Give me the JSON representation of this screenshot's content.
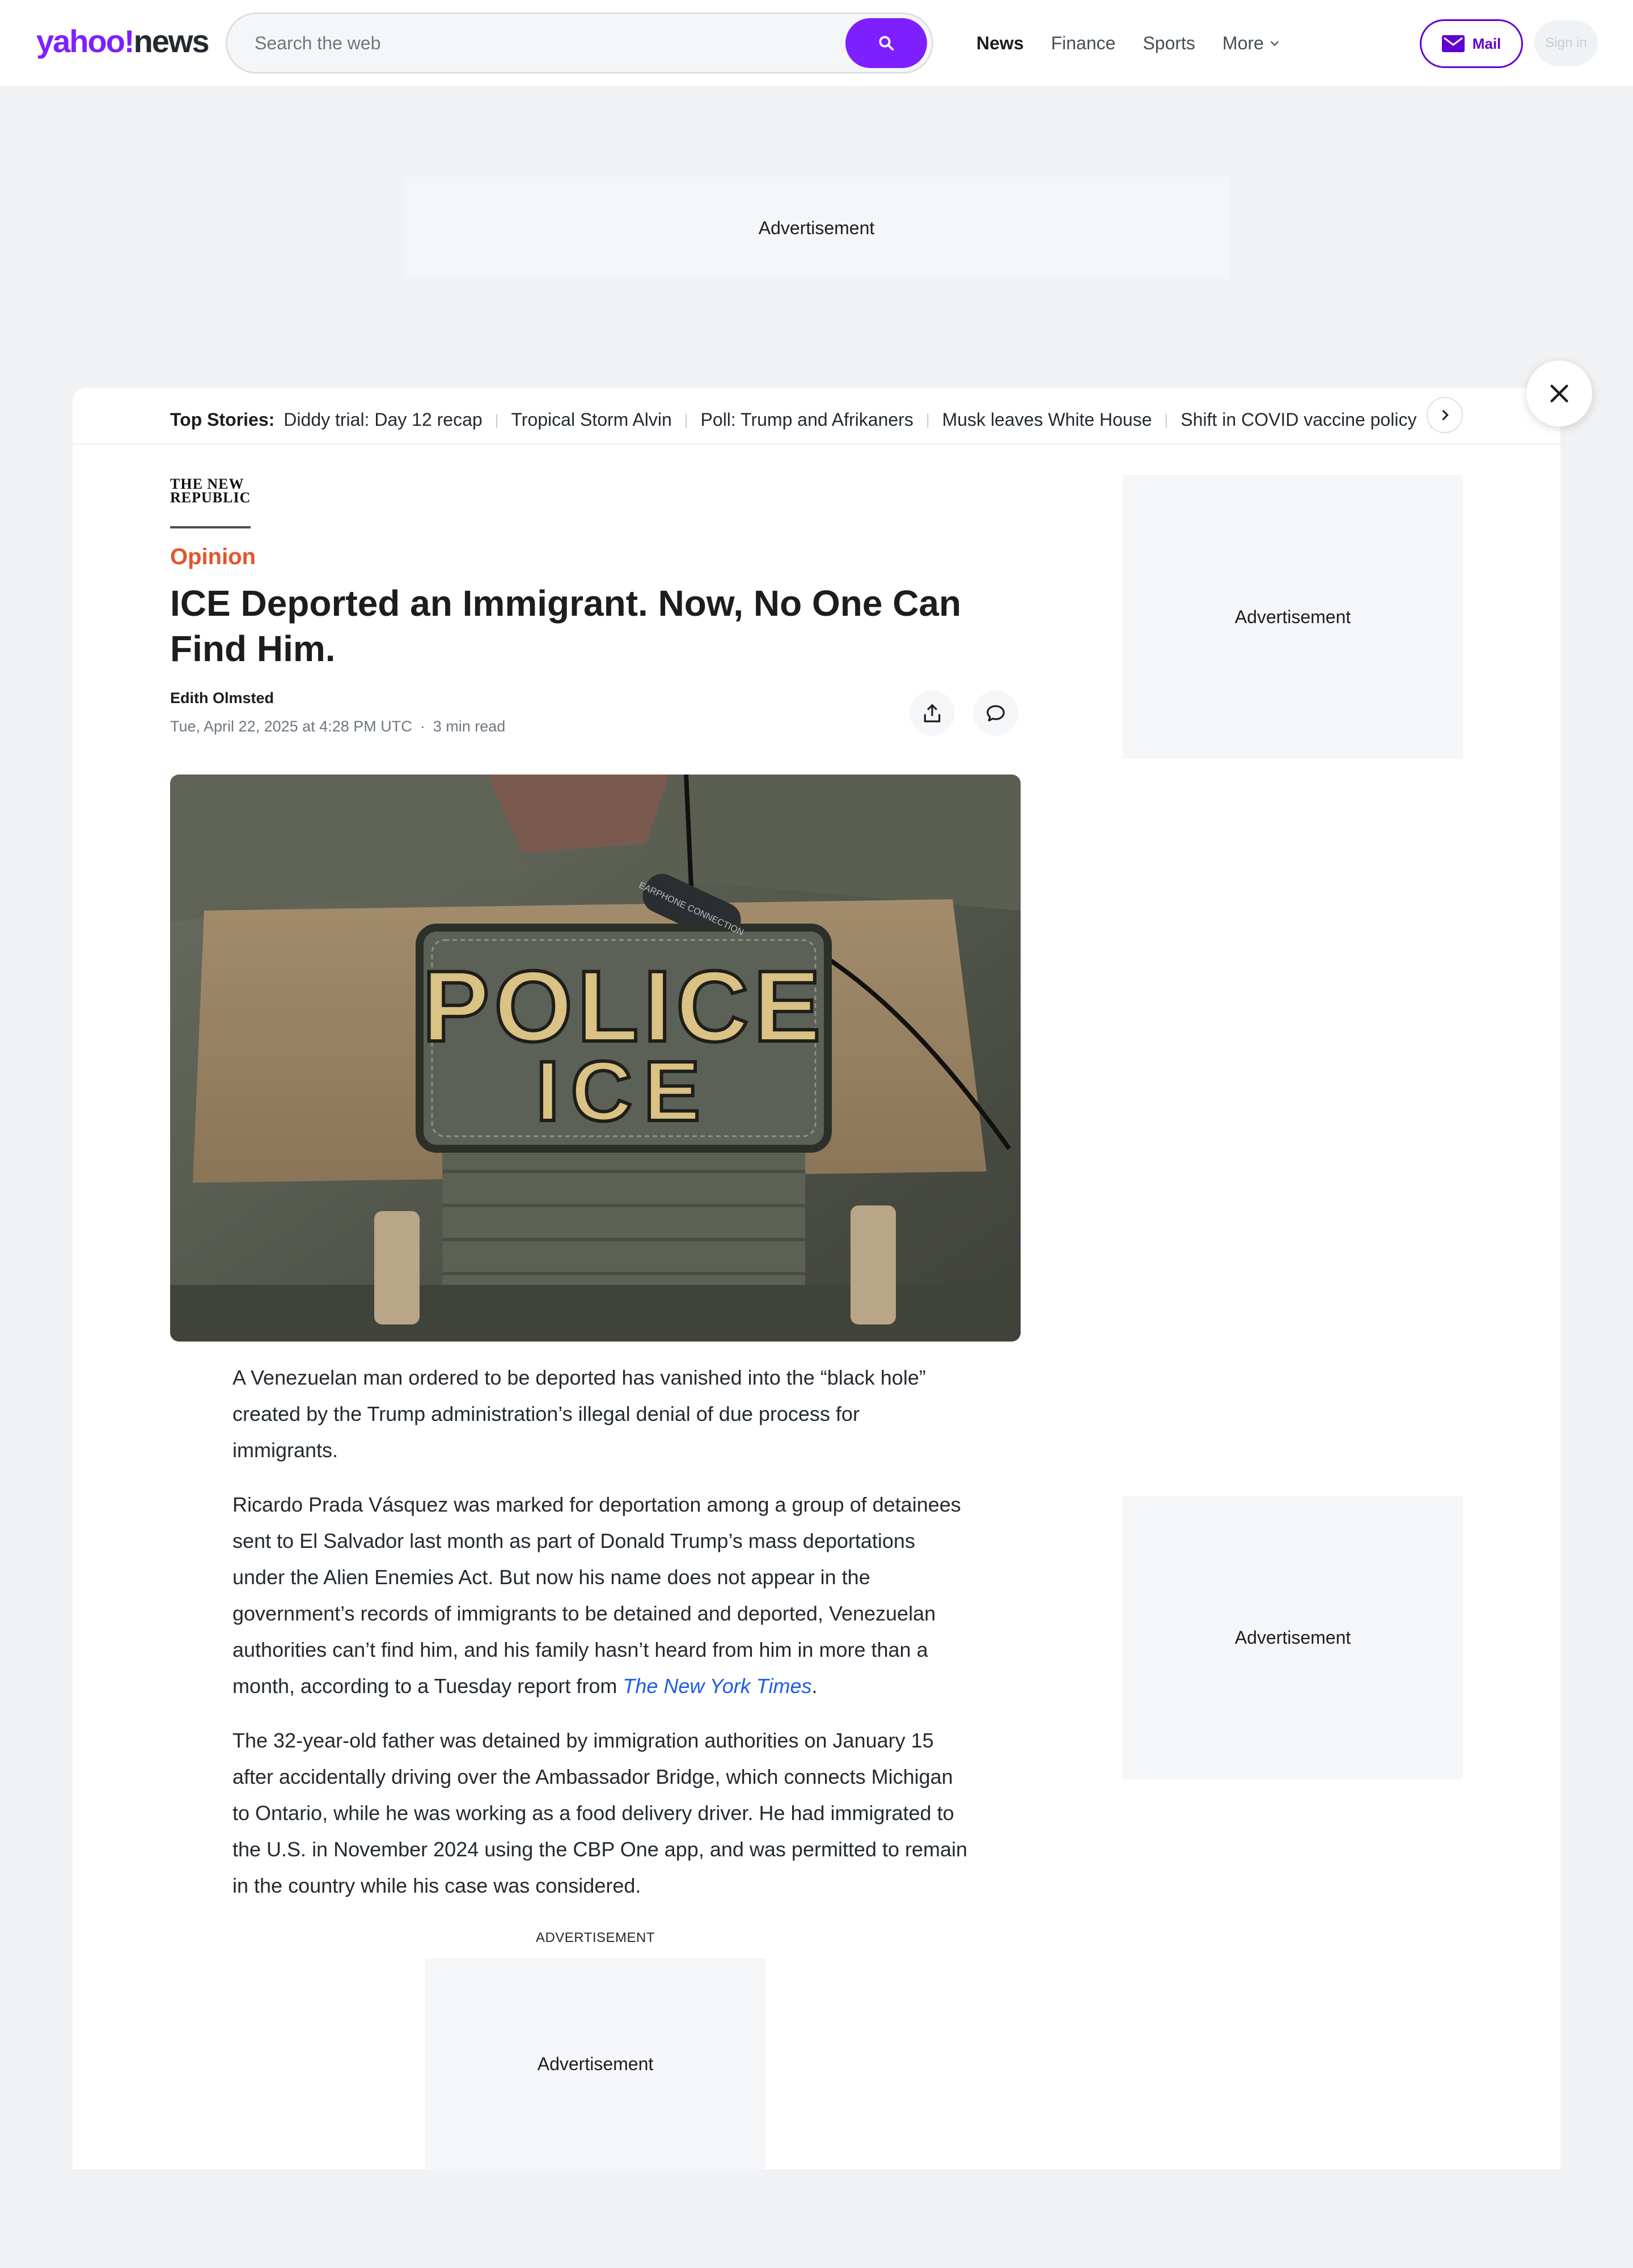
{
  "header": {
    "logo_yahoo": "yahoo!",
    "logo_news": "news",
    "search_placeholder": "Search the web",
    "nav": [
      {
        "label": "News"
      },
      {
        "label": "Finance"
      },
      {
        "label": "Sports"
      },
      {
        "label": "More"
      }
    ],
    "mail_label": "Mail",
    "signin_label": "Sign in",
    "colors": {
      "brand": "#7e1fff",
      "mail": "#6001d2"
    }
  },
  "ads": {
    "top": "Advertisement",
    "right_1": "Advertisement",
    "right_2": "Advertisement",
    "inline_label": "ADVERTISEMENT",
    "inline": "Advertisement"
  },
  "top_stories": {
    "label": "Top Stories:",
    "items": [
      "Diddy trial: Day 12 recap",
      "Tropical Storm Alvin",
      "Poll: Trump and Afrikaners",
      "Musk leaves White House",
      "Shift in COVID vaccine policy"
    ]
  },
  "article": {
    "publisher": "THE NEW REPUBLIC",
    "category": "Opinion",
    "category_color": "#e6532d",
    "headline": "ICE Deported an Immigrant. Now, No One Can Find Him.",
    "author": "Edith Olmsted",
    "date": "Tue, April 22, 2025 at 4:28 PM UTC",
    "read_time": "3 min read",
    "image_text": {
      "line1": "POLICE",
      "line2": "ICE",
      "earpiece": "EARPHONE CONNECTION"
    },
    "paragraphs": {
      "p1": "A Venezuelan man ordered to be deported has vanished into the “black hole” created by the Trump administration’s illegal denial of due process for immigrants.",
      "p2_text": "Ricardo Prada Vásquez was marked for deportation among a group of detainees sent to El Salvador last month as part of Donald Trump’s mass deportations under the Alien Enemies Act. But now his name does not appear in the government’s records of immigrants to be detained and deported, Venezuelan authorities can’t find him, and his family hasn’t heard from him in more than a month, according to a Tuesday report from ",
      "p2_link": "The New York Times",
      "p2_end": ".",
      "p3": "The 32-year-old father was detained by immigration authorities on January 15 after accidentally driving over the Ambassador Bridge, which connects Michigan to Ontario, while he was working as a food delivery driver. He had immigrated to the U.S. in November 2024 using the CBP One app, and was permitted to remain in the country while his case was considered."
    }
  }
}
